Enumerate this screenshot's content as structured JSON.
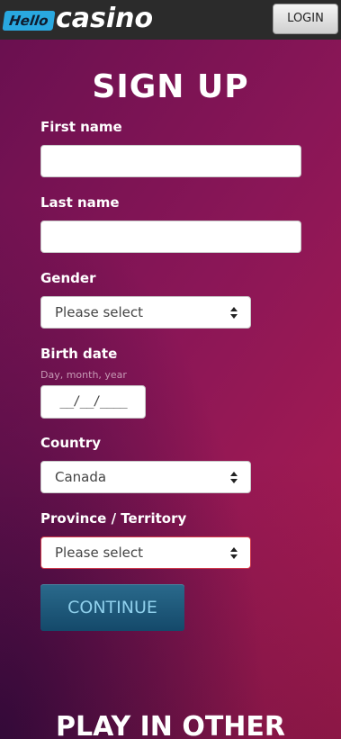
{
  "header": {
    "logo_badge": "Hello",
    "logo_text": "casino",
    "login_label": "LOGIN"
  },
  "form": {
    "title": "SIGN UP",
    "first_name_label": "First name",
    "first_name_value": "",
    "last_name_label": "Last name",
    "last_name_value": "",
    "gender_label": "Gender",
    "gender_value": "Please select",
    "birth_date_label": "Birth date",
    "birth_date_hint": "Day, month, year",
    "birth_date_value": "__/__/____",
    "country_label": "Country",
    "country_value": "Canada",
    "province_label": "Province / Territory",
    "province_value": "Please select",
    "continue_label": "CONTINUE"
  },
  "footer": {
    "play_other_heading": "PLAY IN OTHER"
  },
  "colors": {
    "topbar": "#2b2b2b",
    "logo_badge": "#29a8e0",
    "continue_button": "#1f5b7c",
    "continue_text": "#8fd0ec",
    "background_start": "#6a1050",
    "background_end": "#b01d4f",
    "error_border": "#d23a4a"
  }
}
